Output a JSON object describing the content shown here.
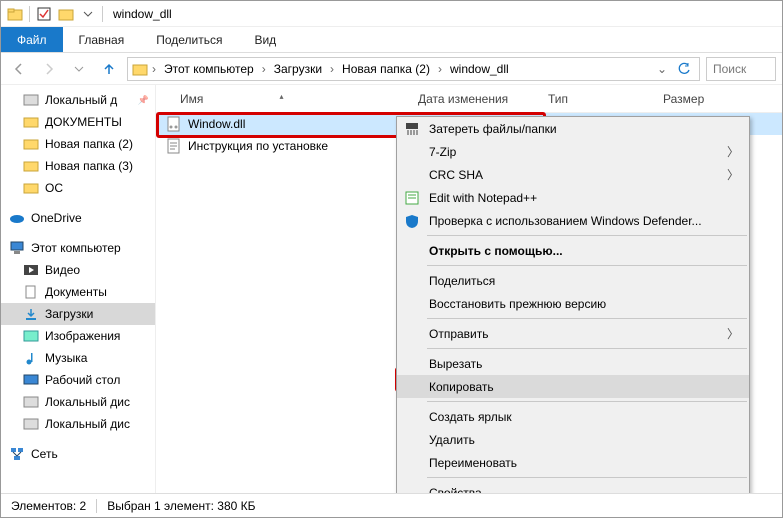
{
  "title": "window_dll",
  "ribbon": {
    "file": "Файл",
    "home": "Главная",
    "share": "Поделиться",
    "view": "Вид"
  },
  "breadcrumb": [
    "Этот компьютер",
    "Загрузки",
    "Новая папка (2)",
    "window_dll"
  ],
  "search_placeholder": "Поиск",
  "columns": {
    "name": "Имя",
    "date": "Дата изменения",
    "type": "Тип",
    "size": "Размер"
  },
  "tree": {
    "local": "Локальный д",
    "docs": "ДОКУМЕНТЫ",
    "np2": "Новая папка (2)",
    "np3": "Новая папка (3)",
    "os": "ОС",
    "onedrive": "OneDrive",
    "thispc": "Этот компьютер",
    "video": "Видео",
    "documents": "Документы",
    "downloads": "Загрузки",
    "images": "Изображения",
    "music": "Музыка",
    "desktop": "Рабочий стол",
    "ld1": "Локальный дис",
    "ld2": "Локальный дис",
    "network": "Сеть"
  },
  "files": [
    {
      "name": "Window.dll"
    },
    {
      "name": "Инструкция по установке"
    }
  ],
  "ctx": {
    "wipe": "Затереть файлы/папки",
    "sevenzip": "7-Zip",
    "crc": "CRC SHA",
    "notepad": "Edit with Notepad++",
    "defender": "Проверка с использованием Windows Defender...",
    "openwith": "Открыть с помощью...",
    "share": "Поделиться",
    "restore": "Восстановить прежнюю версию",
    "sendto": "Отправить",
    "cut": "Вырезать",
    "copy": "Копировать",
    "shortcut": "Создать ярлык",
    "delete": "Удалить",
    "rename": "Переименовать",
    "props": "Свойства"
  },
  "status": {
    "count": "Элементов: 2",
    "sel": "Выбран 1 элемент: 380 КБ"
  }
}
